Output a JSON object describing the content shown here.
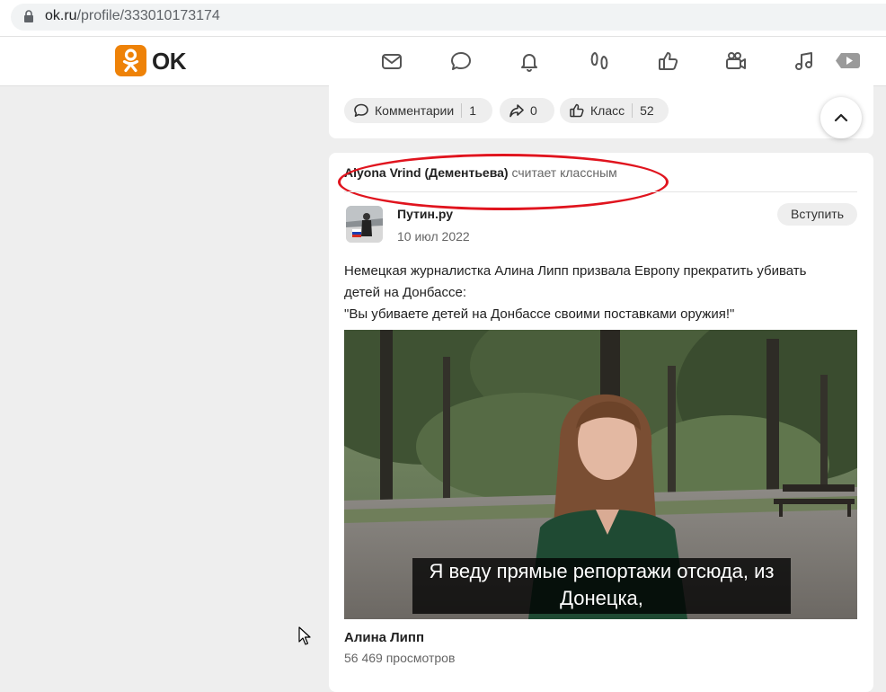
{
  "browser": {
    "url_host": "ok.ru",
    "url_path": "/profile/333010173174"
  },
  "header": {
    "logo_text": "OK",
    "brand_color": "#ee8208",
    "nav_icons": [
      "mail-icon",
      "chat-icon",
      "bell-icon",
      "guests-icon",
      "like-icon",
      "video-camera-icon",
      "music-icon",
      "video-play-icon"
    ]
  },
  "prev_post_actions": {
    "comments_label": "Комментарии",
    "comments_count": "1",
    "shares_count": "0",
    "klass_label": "Класс",
    "klass_count": "52"
  },
  "activity": {
    "user": "Alyona Vrind (Дементьева)",
    "action": "считает классным",
    "highlight_color": "#e0141e"
  },
  "post": {
    "group_name": "Путин.ру",
    "date": "10 июл 2022",
    "join_label": "Вступить",
    "text_lines": [
      "Немецкая журналистка Алина Липп призвала Европу прекратить убивать",
      "детей на Донбассе:",
      "\"Вы убиваете детей на Донбассе своими поставками оружия!\""
    ],
    "video": {
      "subtitle_lines": [
        "Я веду прямые репортажи отсюда, из",
        "Донецка,"
      ],
      "title": "Алина Липп",
      "views": "56 469 просмотров"
    }
  }
}
